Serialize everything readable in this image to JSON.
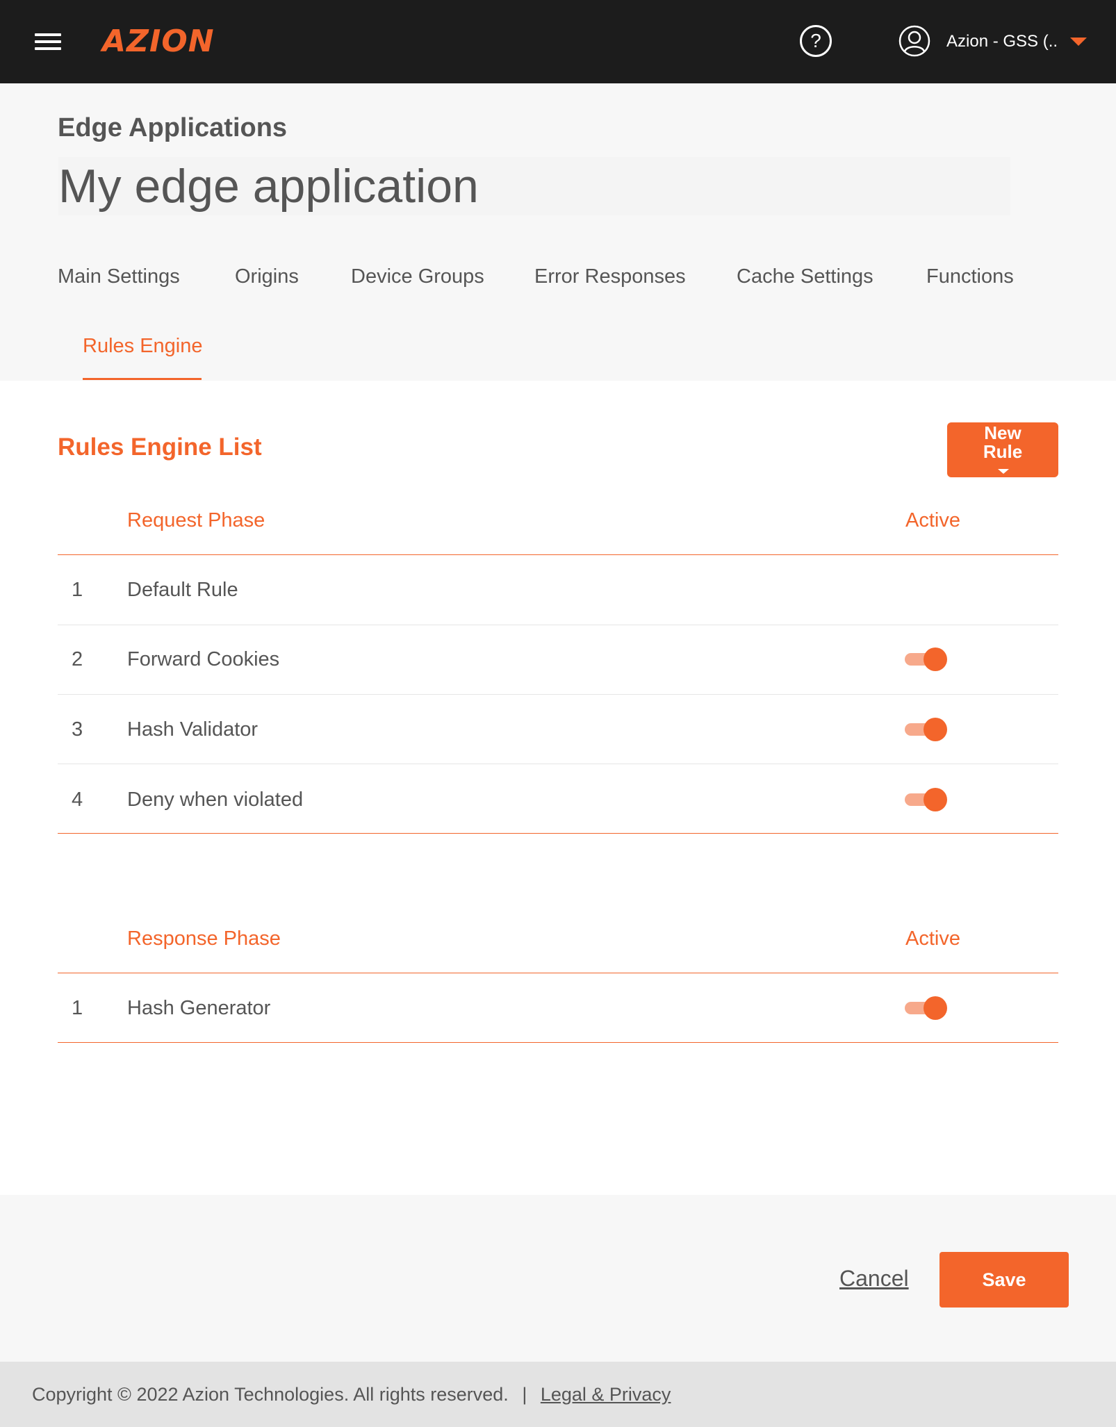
{
  "brand": {
    "logo_text": "AZION",
    "accent_color": "#f3652b"
  },
  "topbar": {
    "menu_icon": "hamburger-menu-icon",
    "help_icon": "question-circle-icon",
    "help_glyph": "?",
    "user_icon": "user-circle-icon",
    "account_name": "Azion - GSS (...",
    "account_caret_icon": "caret-down-icon"
  },
  "header": {
    "breadcrumb": "Edge Applications",
    "app_name": "My edge application"
  },
  "tabs": [
    {
      "label": "Main Settings",
      "active": false
    },
    {
      "label": "Origins",
      "active": false
    },
    {
      "label": "Device Groups",
      "active": false
    },
    {
      "label": "Error Responses",
      "active": false
    },
    {
      "label": "Cache Settings",
      "active": false
    },
    {
      "label": "Functions",
      "active": false
    },
    {
      "label": "Rules Engine",
      "active": true
    }
  ],
  "rules": {
    "title": "Rules Engine List",
    "new_rule_label": "New Rule",
    "request_phase": {
      "header": "Request Phase",
      "active_header": "Active",
      "rows": [
        {
          "index": "1",
          "name": "Default Rule",
          "has_toggle": false
        },
        {
          "index": "2",
          "name": "Forward Cookies",
          "has_toggle": true,
          "active": true
        },
        {
          "index": "3",
          "name": "Hash Validator",
          "has_toggle": true,
          "active": true
        },
        {
          "index": "4",
          "name": "Deny when violated",
          "has_toggle": true,
          "active": true
        }
      ]
    },
    "response_phase": {
      "header": "Response Phase",
      "active_header": "Active",
      "rows": [
        {
          "index": "1",
          "name": "Hash Generator",
          "has_toggle": true,
          "active": true
        }
      ]
    }
  },
  "actions": {
    "cancel_label": "Cancel",
    "save_label": "Save"
  },
  "footer": {
    "copyright": "Copyright © 2022 Azion Technologies. All rights reserved.",
    "separator": "|",
    "legal_link": "Legal & Privacy"
  }
}
